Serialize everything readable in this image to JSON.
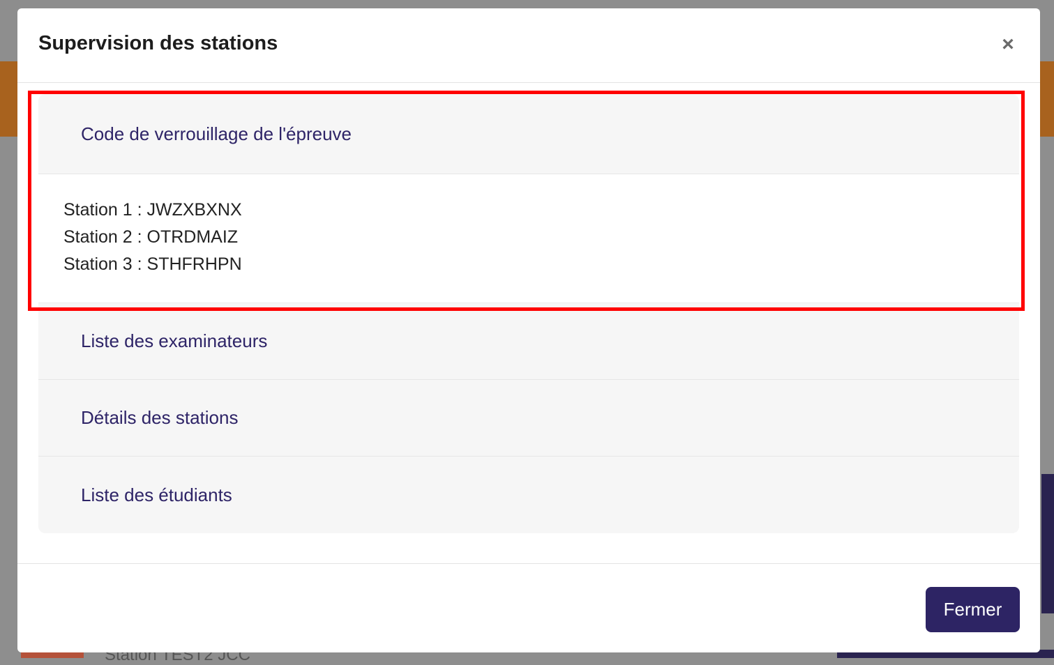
{
  "modal": {
    "title": "Supervision des stations",
    "close_symbol": "×",
    "close_icon": "close-icon"
  },
  "accordion": {
    "sections": [
      {
        "label": "Code de verrouillage de l'épreuve",
        "expanded": true
      },
      {
        "label": "Liste des examinateurs",
        "expanded": false
      },
      {
        "label": "Détails des stations",
        "expanded": false
      },
      {
        "label": "Liste des étudiants",
        "expanded": false
      }
    ],
    "lock_codes": [
      "Station 1 : JWZXBXNX",
      "Station 2 : OTRDMAIZ",
      "Station 3 : STHFRHPN"
    ]
  },
  "footer": {
    "close_label": "Fermer"
  },
  "background": {
    "partial_text": "Station TEST2 JCC"
  },
  "colors": {
    "accent": "#2d2464",
    "section_label": "#2e2467",
    "highlight_border": "#ff0000"
  }
}
